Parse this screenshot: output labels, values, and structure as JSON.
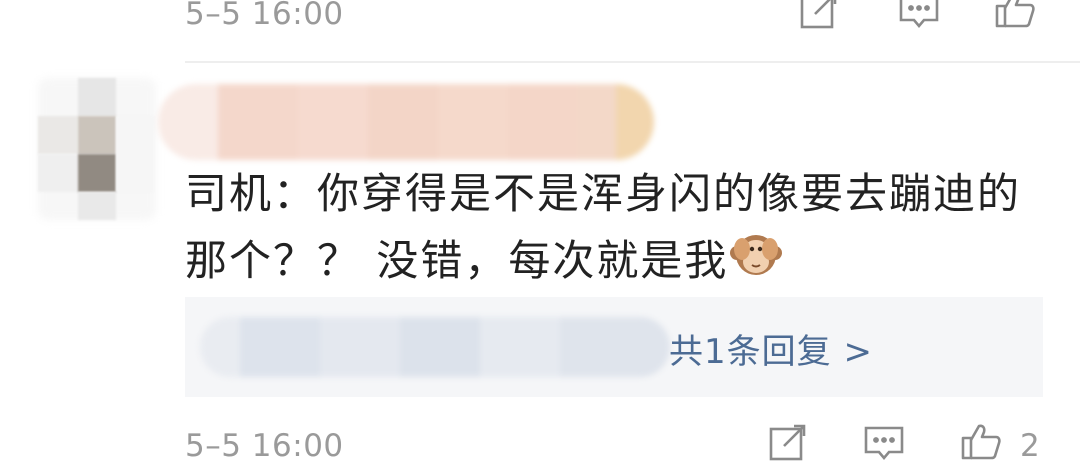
{
  "previous_comment": {
    "timestamp": "5–5 16:00",
    "actions": {
      "share_icon": "share-icon",
      "reply_icon": "comment-icon",
      "like_icon": "thumbs-up-icon"
    }
  },
  "comment": {
    "text_line1": "司机：你穿得是不是浑身闪的像要去蹦迪的",
    "text_line2": "那个？？ 没错，每次就是我",
    "emoji": "see-no-evil-monkey-emoji",
    "replies_link": "共1条回复 >",
    "timestamp": "5–5 16:00",
    "like_count": "2",
    "actions": {
      "share_icon": "share-icon",
      "reply_icon": "comment-icon",
      "like_icon": "thumbs-up-icon"
    }
  },
  "colors": {
    "timestamp": "#9a9a9a",
    "text": "#222222",
    "link": "#4c6b94",
    "reply_bg": "#f5f6f8"
  }
}
